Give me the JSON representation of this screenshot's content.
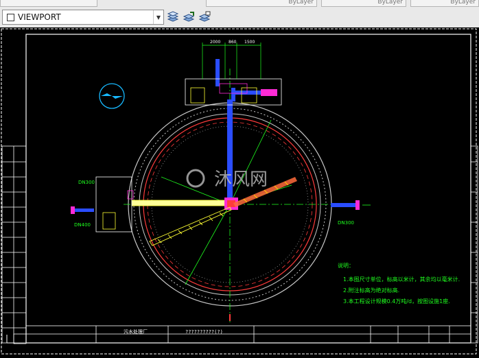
{
  "toolbar": {
    "viewport_combo": {
      "value": "VIEWPORT"
    },
    "layer_controls": [
      {
        "label": "ByLayer"
      },
      {
        "label": "ByLayer"
      },
      {
        "label": "ByLayer"
      }
    ],
    "tool_icons": [
      "layer-properties-icon",
      "layer-states-icon",
      "layer-match-icon"
    ]
  },
  "drawing": {
    "dimensions_top": [
      "2000",
      "860",
      "1500"
    ],
    "left_labels": [
      "DN300",
      "DN400"
    ],
    "right_labels": [
      "DN300"
    ],
    "notes_heading": "说明：",
    "notes": [
      "1.本图尺寸单位，标高以米计，其余均以毫米计.",
      "2.附注标高为绝对标高.",
      "3.本工程设计规模0.4万吨/d，按图设施1座."
    ],
    "title_block": {
      "drawing_title": "污水处理厂",
      "drawing_name": "??????????(?)"
    },
    "watermark": "沐风网",
    "colors": {
      "background": "#000000",
      "frame": "#ffffff",
      "tank_outer": "#c8c8c8",
      "tank_inner": "#ff3b3b",
      "pipe_blue": "#2a4dff",
      "pipe_magenta": "#ff2bd6",
      "annotation_green": "#1fff1f",
      "bridge_yellow": "#ffff33"
    }
  }
}
